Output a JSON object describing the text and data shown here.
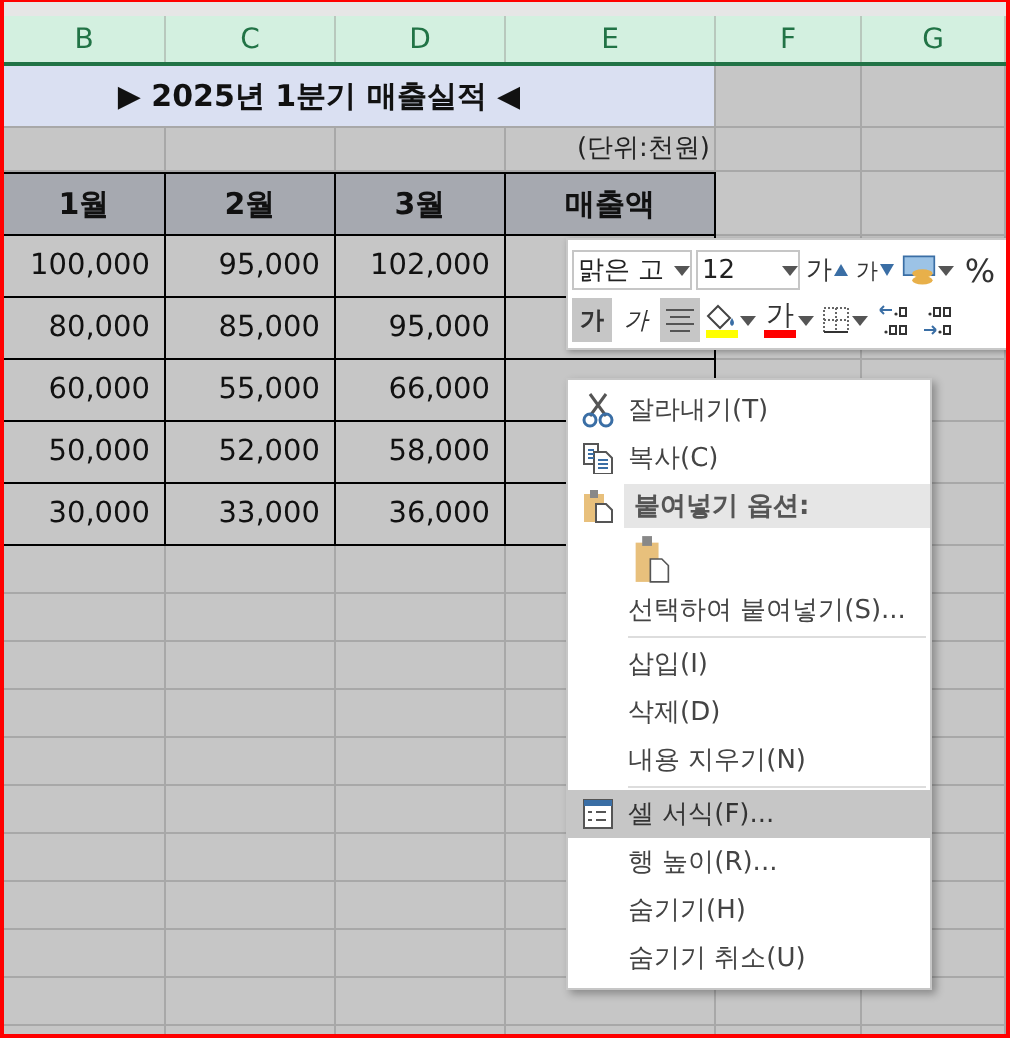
{
  "columns": [
    "B",
    "C",
    "D",
    "E",
    "F",
    "G"
  ],
  "title": "▶ 2025년 1분기 매출실적 ◀",
  "unit": "(단위:천원)",
  "headers": [
    "1월",
    "2월",
    "3월",
    "매출액"
  ],
  "rows": [
    [
      "100,000",
      "95,000",
      "102,000"
    ],
    [
      "80,000",
      "85,000",
      "95,000"
    ],
    [
      "60,000",
      "55,000",
      "66,000"
    ],
    [
      "50,000",
      "52,000",
      "58,000"
    ],
    [
      "30,000",
      "33,000",
      "36,000"
    ]
  ],
  "mini_toolbar": {
    "font_name": "맑은 고",
    "font_size": "12",
    "top_buttons": [
      {
        "kind": "grow-font",
        "label": "가"
      },
      {
        "kind": "shrink-font",
        "label": "가"
      },
      {
        "kind": "cell-style"
      },
      {
        "kind": "percent",
        "label": "%"
      }
    ],
    "bottom_buttons": [
      {
        "kind": "bold",
        "label": "가",
        "selected": true
      },
      {
        "kind": "italic",
        "label": "가",
        "selected": false
      },
      {
        "kind": "align-center",
        "selected": true
      },
      {
        "kind": "fill-color",
        "color": "#ffff00"
      },
      {
        "kind": "font-color",
        "label": "가",
        "color": "#ff0000"
      },
      {
        "kind": "borders"
      },
      {
        "kind": "decimal-increase"
      },
      {
        "kind": "decimal-decrease"
      }
    ]
  },
  "context_menu": {
    "items": [
      {
        "kind": "cut",
        "label": "잘라내기(T)",
        "selected": false
      },
      {
        "kind": "copy",
        "label": "복사(C)",
        "selected": false
      },
      {
        "kind": "paste-header",
        "label": "붙여넣기 옵션:"
      },
      {
        "kind": "paste-option"
      },
      {
        "kind": "item",
        "label": "선택하여 붙여넣기(S)...",
        "selected": false
      },
      {
        "kind": "separator"
      },
      {
        "kind": "item",
        "label": "삽입(I)",
        "selected": false
      },
      {
        "kind": "item",
        "label": "삭제(D)",
        "selected": false
      },
      {
        "kind": "item",
        "label": "내용 지우기(N)",
        "selected": false
      },
      {
        "kind": "separator"
      },
      {
        "kind": "format-cells",
        "label": "셀 서식(F)...",
        "selected": true
      },
      {
        "kind": "item",
        "label": "행 높이(R)...",
        "selected": false
      },
      {
        "kind": "item",
        "label": "숨기기(H)",
        "selected": false
      },
      {
        "kind": "item",
        "label": "숨기기 취소(U)",
        "selected": false
      }
    ]
  }
}
